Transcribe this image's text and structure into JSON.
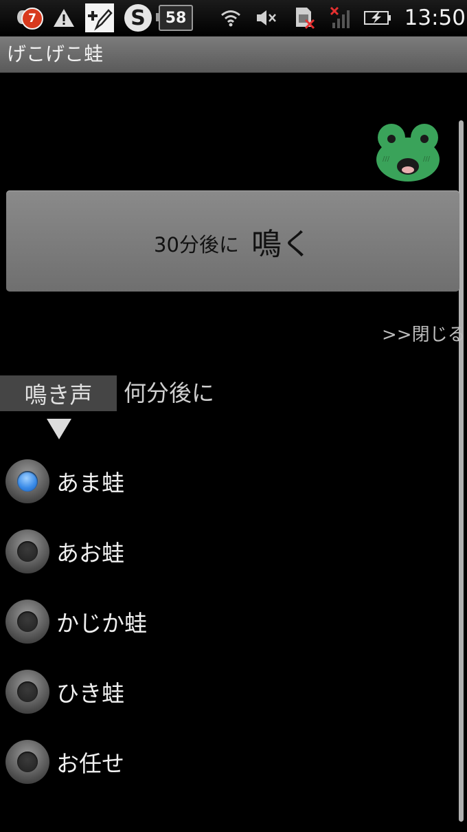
{
  "status_bar": {
    "notification_count": "7",
    "battery_level": "58",
    "time": "13:50",
    "icons": [
      "notification-badge-icon",
      "warning-icon",
      "edit-icon",
      "skype-icon",
      "battery-indicator-icon",
      "wifi-icon",
      "muted-icon",
      "sim-error-icon",
      "no-signal-icon",
      "charging-battery-icon"
    ]
  },
  "app": {
    "title": "げこげこ蛙"
  },
  "main_button": {
    "time_label": "30分後に",
    "action_label": "鳴く"
  },
  "close_link": ">>閉じる",
  "tabs": [
    {
      "label": "鳴き声",
      "active": true
    },
    {
      "label": "何分後に",
      "active": false
    }
  ],
  "sound_options": [
    {
      "label": "あま蛙",
      "selected": true
    },
    {
      "label": "あお蛙",
      "selected": false
    },
    {
      "label": "かじか蛙",
      "selected": false
    },
    {
      "label": "ひき蛙",
      "selected": false
    },
    {
      "label": "お任せ",
      "selected": false
    }
  ],
  "colors": {
    "accent_radio": "#3a8be8",
    "frog_green": "#3aa35a",
    "button_gray": "#7a7a7a"
  }
}
